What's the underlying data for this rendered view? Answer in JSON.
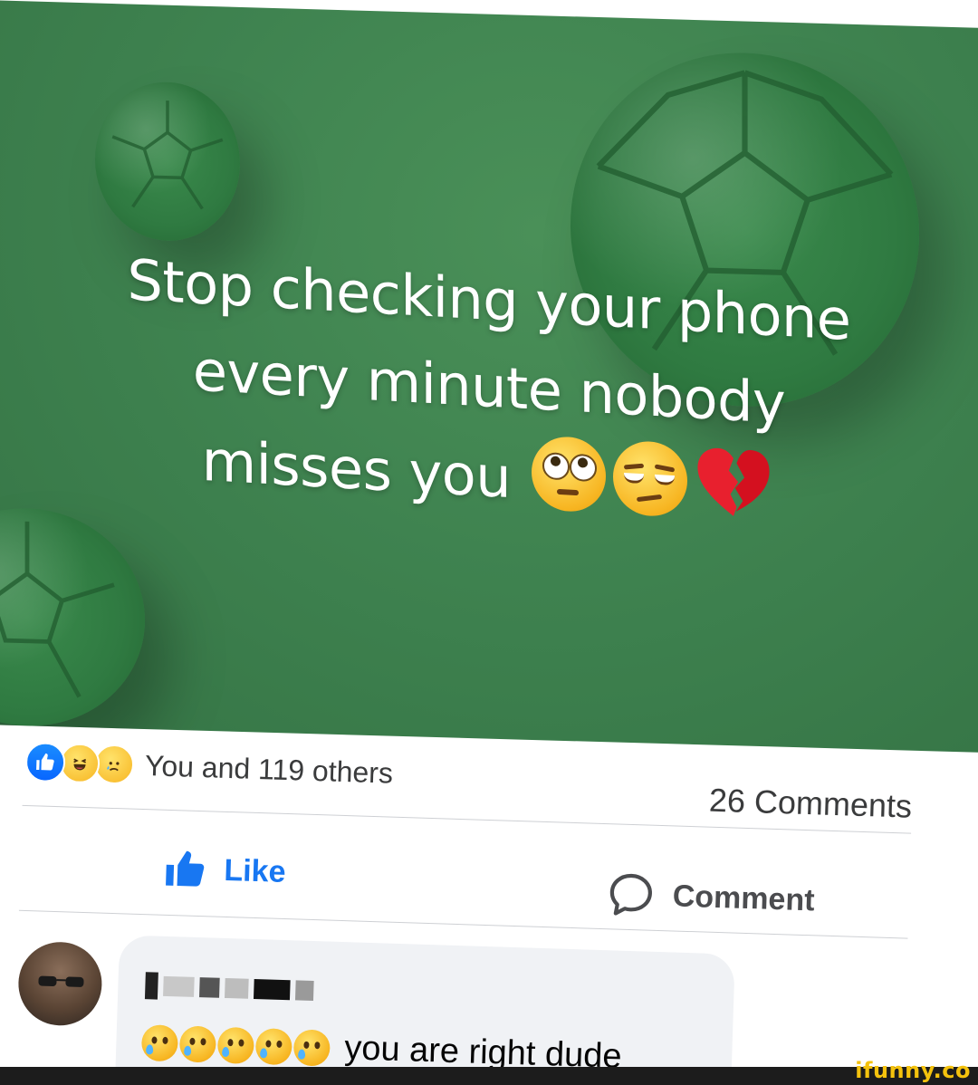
{
  "post": {
    "headline_line1": "Stop checking your phone",
    "headline_line2": "every minute nobody",
    "headline_line3": "misses you",
    "headline_emojis": [
      "face-with-rolling-eyes",
      "unamused-face",
      "broken-heart"
    ],
    "background_color": "#3f8350"
  },
  "reactions": {
    "icons": [
      "like",
      "haha",
      "sad"
    ],
    "summary": "You and 119 others",
    "comments_count": "26 Comments"
  },
  "actions": {
    "like_label": "Like",
    "comment_label": "Comment",
    "like_color": "#1877f2"
  },
  "comment": {
    "author_name": "",
    "author_name_redacted": true,
    "emojis": [
      "sad-but-relieved-face",
      "sad-but-relieved-face",
      "sad-but-relieved-face",
      "sad-but-relieved-face",
      "sad-but-relieved-face"
    ],
    "text": "you are right dude"
  },
  "watermark": "ifunny.co"
}
